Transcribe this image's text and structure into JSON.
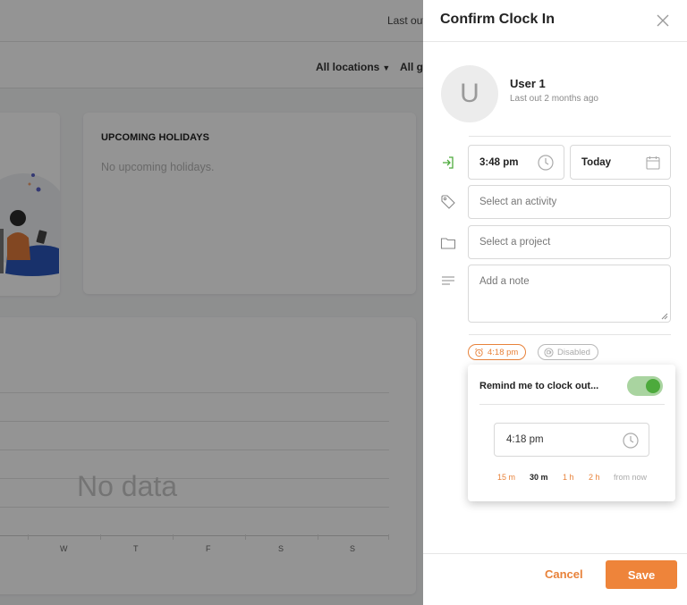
{
  "background": {
    "topbar": {
      "last_out": "Last out"
    },
    "filters": {
      "locations": "All locations",
      "groups": "All g"
    },
    "holidays_card": {
      "title": "UPCOMING HOLIDAYS",
      "empty_text": "No upcoming holidays."
    },
    "chart_card": {
      "empty_text": "No data",
      "days": [
        "W",
        "T",
        "F",
        "S",
        "S"
      ]
    }
  },
  "drawer": {
    "title": "Confirm Clock In",
    "user": {
      "initial": "U",
      "name": "User 1",
      "last_out": "Last out 2 months ago"
    },
    "clock_in_time": "3:48 pm",
    "clock_in_date": "Today",
    "activity_placeholder": "Select an activity",
    "project_placeholder": "Select a project",
    "note_placeholder": "Add a note",
    "reminder_pill": "4:18 pm",
    "breaks_pill": "Disabled",
    "reminder": {
      "label": "Remind me to clock out...",
      "enabled": true,
      "time": "4:18 pm",
      "quick_options": [
        "15 m",
        "30 m",
        "1 h",
        "2 h"
      ],
      "selected_option": "30 m",
      "suffix": "from now"
    },
    "footer": {
      "cancel_label": "Cancel",
      "save_label": "Save"
    }
  },
  "colors": {
    "accent": "#ee843a",
    "toggle_on": "#4daa3c",
    "clock_in_icon": "#4daa3c"
  },
  "icons": [
    "clock-in-icon",
    "tag-icon",
    "folder-icon",
    "note-lines-icon",
    "clock-icon",
    "calendar-icon",
    "close-icon",
    "alarm-icon",
    "coffee-icon"
  ]
}
